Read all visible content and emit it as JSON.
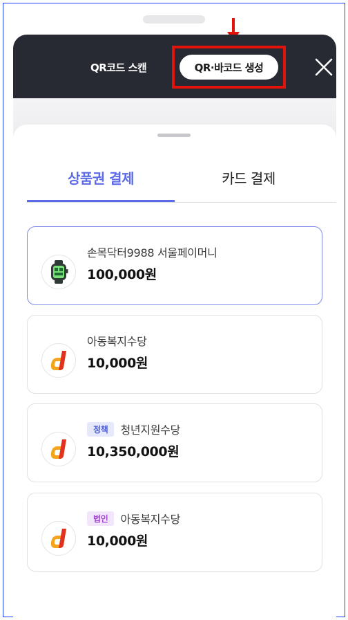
{
  "header": {
    "scan_label": "QR코드 스캔",
    "generate_label": "QR·바코드 생성"
  },
  "tabs": [
    {
      "label": "상품권 결제",
      "active": true
    },
    {
      "label": "카드 결제",
      "active": false
    }
  ],
  "vouchers": [
    {
      "name": "손목닥터9988 서울페이머니",
      "amount": "100,000원",
      "badge": "",
      "icon": "smartwatch-icon",
      "selected": true
    },
    {
      "name": "아동복지수당",
      "amount": "10,000원",
      "badge": "",
      "icon": "d-logo-icon",
      "selected": false
    },
    {
      "name": "청년지원수당",
      "amount": "10,350,000원",
      "badge": "정책",
      "icon": "d-logo-icon",
      "selected": false
    },
    {
      "name": "아동복지수당",
      "amount": "10,000원",
      "badge": "법인",
      "icon": "d-logo-icon",
      "selected": false
    }
  ],
  "colors": {
    "accent": "#5c6be8",
    "header_bg": "#272a33",
    "highlight": "#e3120b",
    "frame": "#1f3fff"
  }
}
